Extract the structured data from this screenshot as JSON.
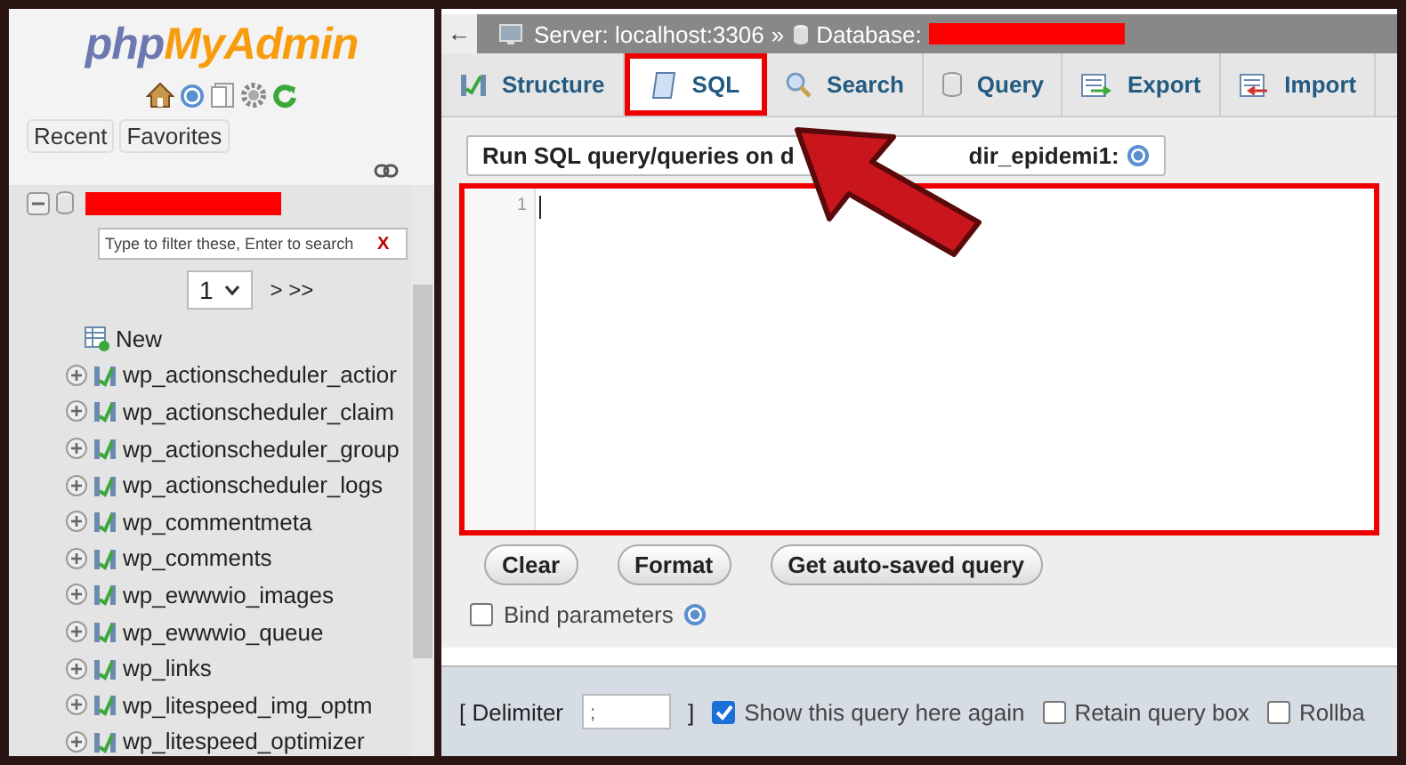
{
  "sidebar": {
    "logo": [
      "php",
      "MyAdmin"
    ],
    "nav_buttons": [
      "Recent",
      "Favorites"
    ],
    "database": {
      "expanded": true
    },
    "filter": {
      "placeholder": "Type to filter these, Enter to search",
      "clear": "X"
    },
    "pager": {
      "page": "1",
      "next": "> >>"
    },
    "new_item": "New",
    "tables": [
      {
        "name": "wp_actionscheduler_actior",
        "expanded": false
      },
      {
        "name": "wp_actionscheduler_claim",
        "expanded": false
      },
      {
        "name": "wp_actionscheduler_group",
        "expanded": false
      },
      {
        "name": "wp_actionscheduler_logs",
        "expanded": false
      },
      {
        "name": "wp_commentmeta",
        "expanded": false
      },
      {
        "name": "wp_comments",
        "expanded": false
      },
      {
        "name": "wp_ewwwio_images",
        "expanded": false
      },
      {
        "name": "wp_ewwwio_queue",
        "expanded": false
      },
      {
        "name": "wp_links",
        "expanded": false
      },
      {
        "name": "wp_litespeed_img_optm",
        "expanded": false
      },
      {
        "name": "wp_litespeed_optimizer",
        "expanded": false
      }
    ]
  },
  "breadcrumb": {
    "back": "←",
    "server": "Server: localhost:3306",
    "separator": "»",
    "database": "Database:"
  },
  "tabs": [
    {
      "label": "Structure",
      "selected": false,
      "kind": "structure"
    },
    {
      "label": "SQL",
      "selected": true,
      "kind": "sql"
    },
    {
      "label": "Search",
      "selected": false,
      "kind": "search"
    },
    {
      "label": "Query",
      "selected": false,
      "kind": "query"
    },
    {
      "label": "Export",
      "selected": false,
      "kind": "export"
    },
    {
      "label": "Import",
      "selected": false,
      "kind": "import"
    }
  ],
  "sql_panel": {
    "legend_start": "Run SQL query/queries on d",
    "legend_end": "dir_epidemi1:",
    "line_number": "1",
    "buttons": [
      "Clear",
      "Format",
      "Get auto-saved query"
    ],
    "bind_parameters": {
      "label": "Bind parameters",
      "checked": false
    }
  },
  "footer": {
    "delimiter_open": "[ Delimiter",
    "delimiter_value": ";",
    "delimiter_close": "]",
    "options": [
      {
        "label": "Show this query here again",
        "checked": true
      },
      {
        "label": "Retain query box",
        "checked": false
      },
      {
        "label": "Rollba",
        "checked": false
      }
    ]
  }
}
